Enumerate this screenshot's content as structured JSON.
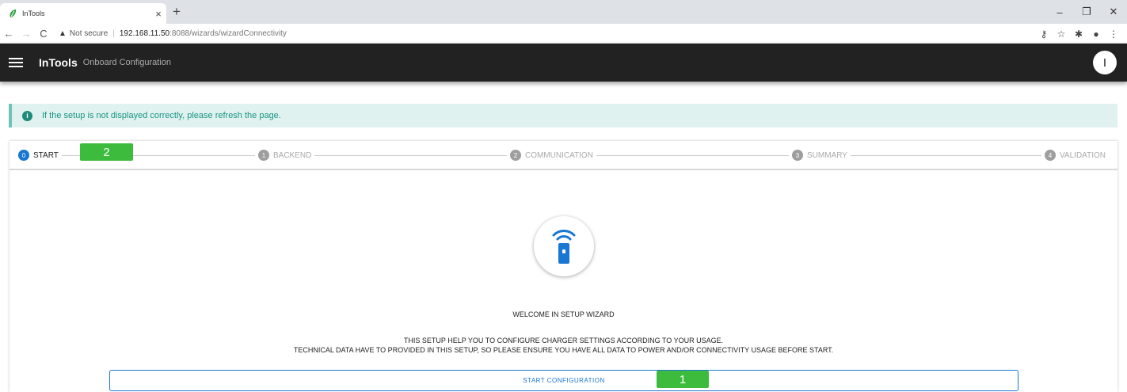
{
  "browser": {
    "tab_title": "InTools",
    "tab_close": "×",
    "new_tab": "+",
    "not_secure": "Not secure",
    "url_host": "192.168.11.50",
    "url_path": ":8088/wizards/wizardConnectivity",
    "window_controls": [
      "–",
      "❐",
      "✕"
    ]
  },
  "appbar": {
    "brand": "InTools",
    "subtitle": "Onboard Configuration",
    "user_initial": "I"
  },
  "alert": {
    "text": "If the setup is not displayed correctly, please refresh the page."
  },
  "stepper": {
    "steps": [
      {
        "num": "0",
        "label": "START",
        "active": true
      },
      {
        "num": "1",
        "label": "BACKEND",
        "active": false
      },
      {
        "num": "2",
        "label": "COMMUNICATION",
        "active": false
      },
      {
        "num": "3",
        "label": "SUMMARY",
        "active": false
      },
      {
        "num": "4",
        "label": "VALIDATION",
        "active": false
      }
    ]
  },
  "markers": {
    "m1": "1",
    "m2": "2"
  },
  "content": {
    "welcome": "WELCOME IN SETUP WIZARD",
    "line1": "THIS SETUP HELP YOU TO CONFIGURE CHARGER SETTINGS ACCORDING TO YOUR USAGE.",
    "line2": "TECHNICAL DATA HAVE TO PROVIDED IN THIS SETUP, SO PLEASE ENSURE YOU HAVE ALL DATA TO POWER AND/OR CONNECTIVITY USAGE BEFORE START.",
    "start_button": "START CONFIGURATION"
  },
  "colors": {
    "appbar": "#222222",
    "accent": "#1976d2",
    "alert_bg": "#e0f2ef",
    "alert_text": "#1a9483",
    "marker": "#3dbb3d"
  }
}
